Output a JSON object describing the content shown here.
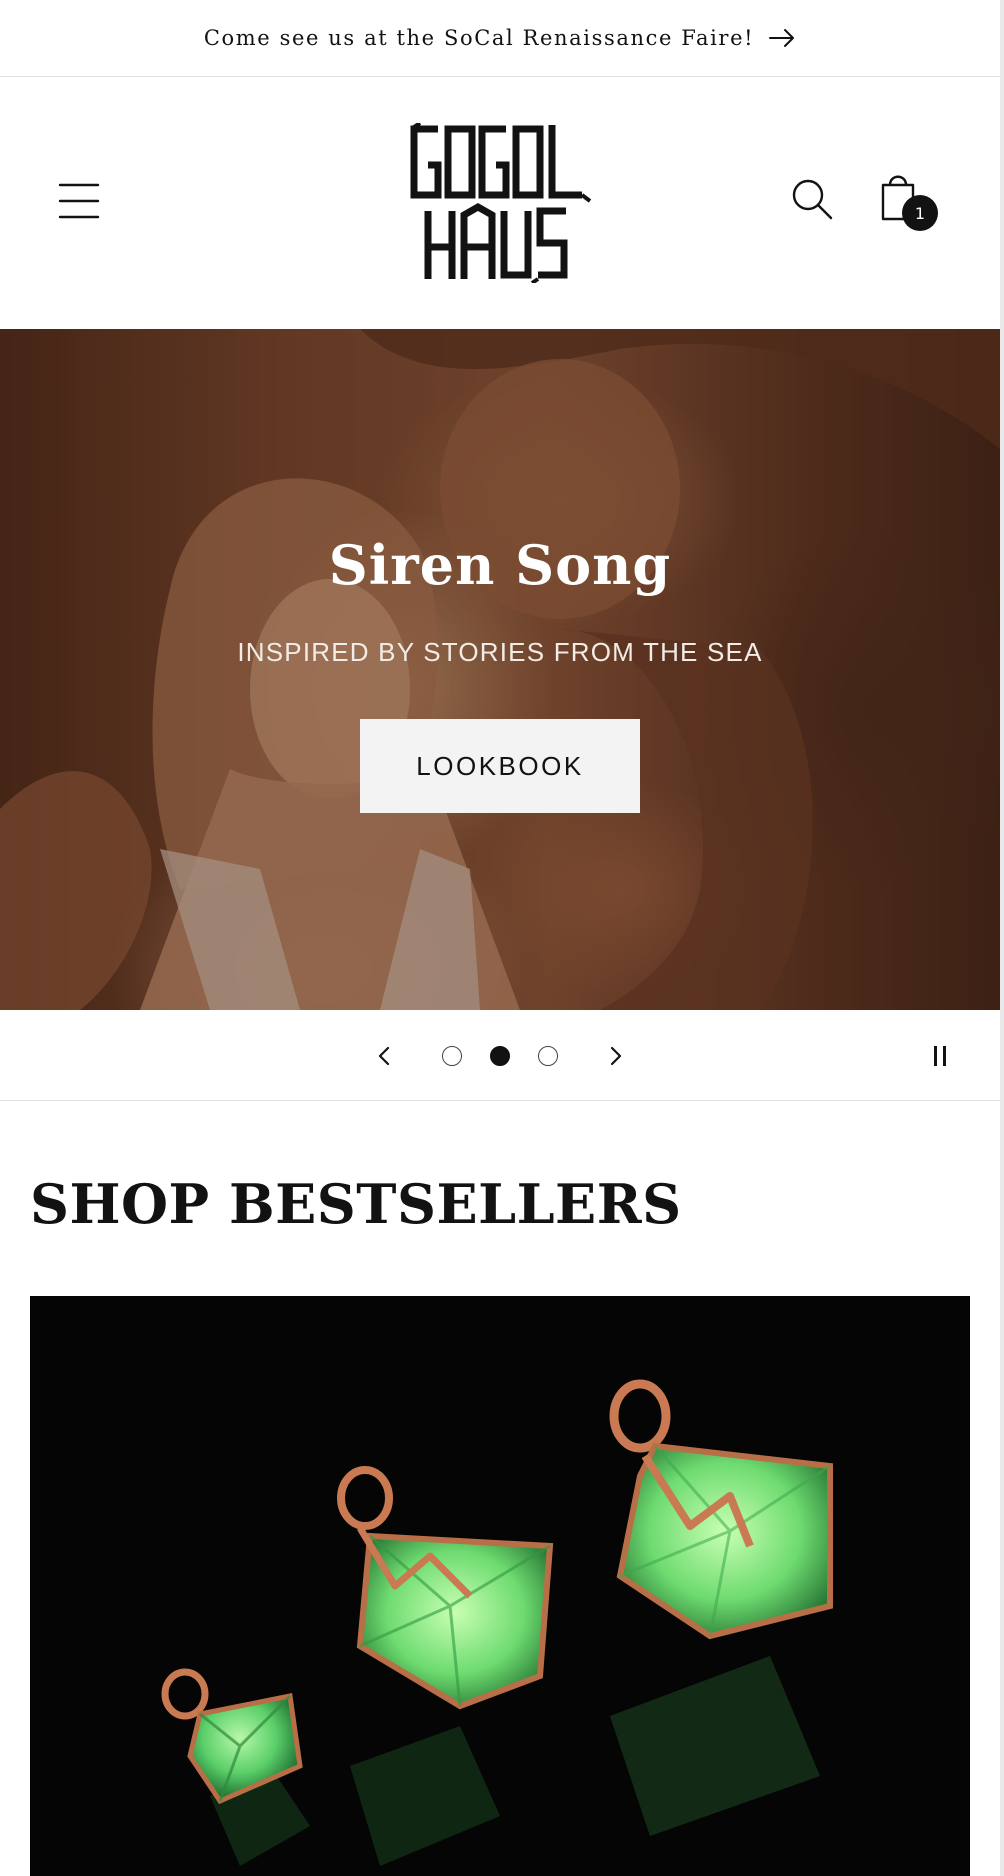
{
  "announcement": {
    "text": "Come see us at the SoCal Renaissance Faire!",
    "arrow_icon": "arrow-right-icon"
  },
  "header": {
    "menu_icon": "hamburger-menu-icon",
    "logo_line1": "GOGOL",
    "logo_line2": "HAUS",
    "search_icon": "search-icon",
    "cart_icon": "shopping-bag-icon",
    "cart_count": "1"
  },
  "hero": {
    "title": "Siren Song",
    "subtitle": "INSPIRED BY STORIES FROM THE SEA",
    "button_label": "LOOKBOOK"
  },
  "slider": {
    "prev_icon": "chevron-left-icon",
    "next_icon": "chevron-right-icon",
    "pause_icon": "pause-icon",
    "slide_count": 3,
    "active_slide": 2
  },
  "bestsellers": {
    "heading": "SHOP BESTSELLERS"
  },
  "colors": {
    "text": "#121212",
    "hero_button_bg": "#f3f3f3",
    "gem_green": "#4fd06a",
    "copper": "#c97a52"
  }
}
